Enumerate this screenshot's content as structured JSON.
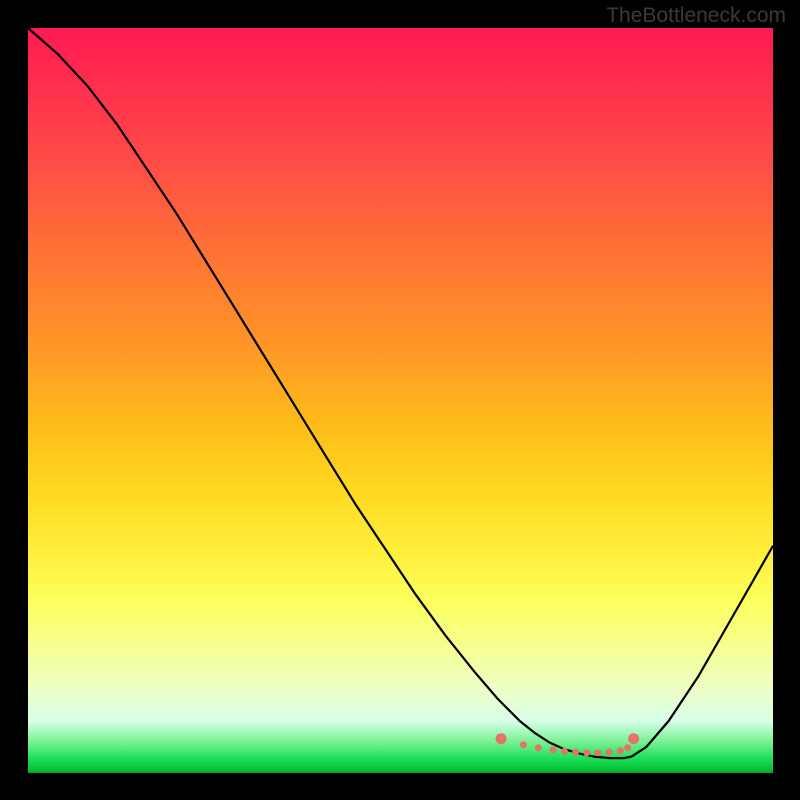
{
  "watermark": "TheBottleneck.com",
  "chart_data": {
    "type": "line",
    "title": "",
    "xlabel": "",
    "ylabel": "",
    "xlim": [
      0,
      100
    ],
    "ylim": [
      0,
      100
    ],
    "series": [
      {
        "name": "curve",
        "x": [
          0,
          4,
          8,
          12,
          16,
          20,
          24,
          28,
          32,
          36,
          40,
          44,
          48,
          52,
          56,
          60,
          63,
          66,
          68,
          70,
          72,
          74,
          76,
          78,
          80,
          81,
          83,
          86,
          90,
          94,
          98,
          100
        ],
        "values": [
          100,
          96.5,
          92.2,
          87,
          81,
          75,
          68.5,
          62,
          55.5,
          49,
          42.5,
          36,
          30,
          24,
          18.5,
          13.5,
          10,
          7,
          5.4,
          4.1,
          3.2,
          2.6,
          2.2,
          2.0,
          2.0,
          2.2,
          3.5,
          7,
          13,
          20,
          27,
          30.5
        ]
      },
      {
        "name": "dots",
        "x": [
          63.5,
          66.5,
          68.5,
          70.5,
          72,
          73.5,
          75,
          76.5,
          78,
          79.5,
          80.5,
          81.3
        ],
        "values": [
          4.6,
          3.8,
          3.4,
          3.1,
          2.9,
          2.8,
          2.7,
          2.7,
          2.8,
          3.0,
          3.4,
          4.6
        ]
      }
    ],
    "gradient": {
      "top_color": "#ff1a54",
      "mid_color": "#ffd820",
      "bottom_color": "#1de05a"
    },
    "curve_color": "#000000",
    "dot_color": "#e57368"
  }
}
